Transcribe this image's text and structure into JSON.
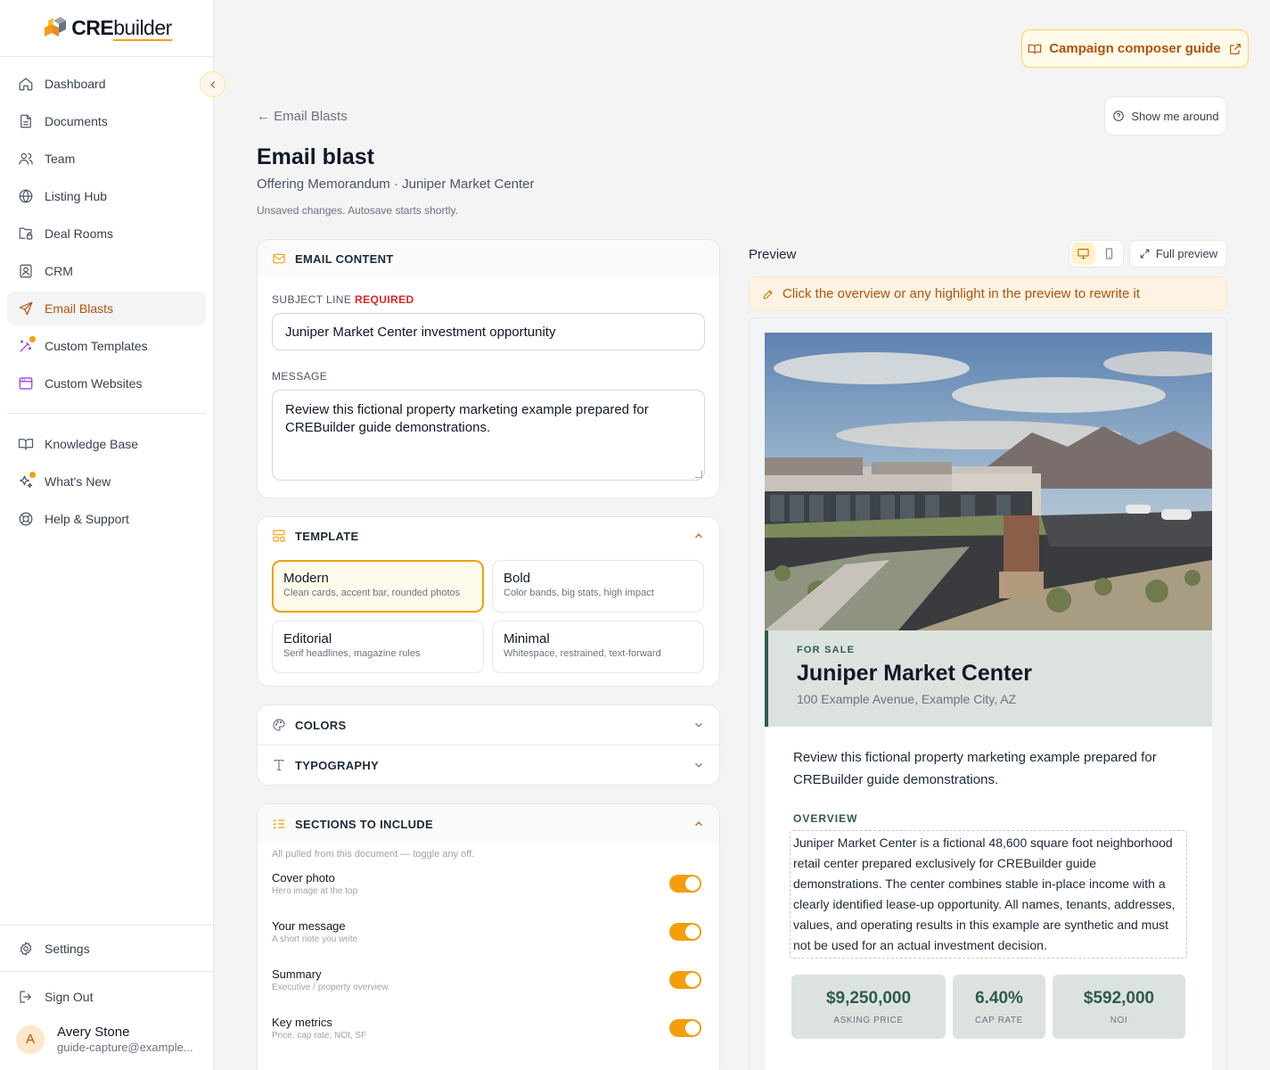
{
  "app": {
    "logo_bold": "CRE",
    "logo_rest": "builder"
  },
  "sidebar": {
    "items": [
      {
        "label": "Dashboard"
      },
      {
        "label": "Documents"
      },
      {
        "label": "Team"
      },
      {
        "label": "Listing Hub"
      },
      {
        "label": "Deal Rooms"
      },
      {
        "label": "CRM"
      },
      {
        "label": "Email Blasts",
        "active": true
      },
      {
        "label": "Custom Templates"
      },
      {
        "label": "Custom Websites"
      }
    ],
    "secondary": [
      {
        "label": "Knowledge Base"
      },
      {
        "label": "What's New"
      },
      {
        "label": "Help & Support"
      }
    ],
    "settings_label": "Settings",
    "signout_label": "Sign Out",
    "user": {
      "initial": "A",
      "name": "Avery Stone",
      "email": "guide-capture@example..."
    }
  },
  "header": {
    "guide_button": "Campaign composer guide",
    "back_link": "← Email Blasts",
    "tour_button": "Show me around",
    "title": "Email blast",
    "subtitle": "Offering Memorandum · Juniper Market Center",
    "save_status": "Unsaved changes. Autosave starts shortly."
  },
  "email_content": {
    "heading": "EMAIL CONTENT",
    "subject_label": "SUBJECT LINE",
    "required_label": "REQUIRED",
    "subject_value": "Juniper Market Center investment opportunity",
    "message_label": "MESSAGE",
    "message_value": "Review this fictional property marketing example prepared for CREBuilder guide demonstrations."
  },
  "template": {
    "heading": "TEMPLATE",
    "options": [
      {
        "name": "Modern",
        "desc": "Clean cards, accent bar, rounded photos",
        "selected": true
      },
      {
        "name": "Bold",
        "desc": "Color bands, big stats, high impact"
      },
      {
        "name": "Editorial",
        "desc": "Serif headlines, magazine rules"
      },
      {
        "name": "Minimal",
        "desc": "Whitespace, restrained, text-forward"
      }
    ]
  },
  "colors": {
    "heading": "COLORS"
  },
  "typography": {
    "heading": "TYPOGRAPHY"
  },
  "sections": {
    "heading": "SECTIONS TO INCLUDE",
    "note": "All pulled from this document — toggle any off.",
    "items": [
      {
        "label": "Cover photo",
        "sub": "Hero image at the top",
        "on": true
      },
      {
        "label": "Your message",
        "sub": "A short note you write",
        "on": true
      },
      {
        "label": "Summary",
        "sub": "Executive / property overview",
        "on": true
      },
      {
        "label": "Key metrics",
        "sub": "Price, cap rate, NOI, SF",
        "on": true
      }
    ]
  },
  "preview": {
    "label": "Preview",
    "full_preview": "Full preview",
    "hint": "Click the overview or any highlight in the preview to rewrite it",
    "for_sale": "FOR SALE",
    "property_name": "Juniper Market Center",
    "address": "100 Example Avenue, Example City, AZ",
    "message": "Review this fictional property marketing example prepared for CREBuilder guide demonstrations.",
    "overview_label": "OVERVIEW",
    "overview_text": "Juniper Market Center is a fictional 48,600 square foot neighborhood retail center prepared exclusively for CREBuilder guide demonstrations. The center combines stable in-place income with a clearly identified lease-up opportunity. All names, tenants, addresses, values, and operating results in this example are synthetic and must not be used for an actual investment decision.",
    "stats": [
      {
        "value": "$9,250,000",
        "label": "ASKING PRICE"
      },
      {
        "value": "6.40%",
        "label": "CAP RATE"
      },
      {
        "value": "$592,000",
        "label": "NOI"
      }
    ]
  },
  "colors_palette": {
    "accent": "#f59e0b",
    "accent_dark": "#b45309",
    "email_green": "#2f5b4a",
    "email_band": "#dce3df"
  }
}
